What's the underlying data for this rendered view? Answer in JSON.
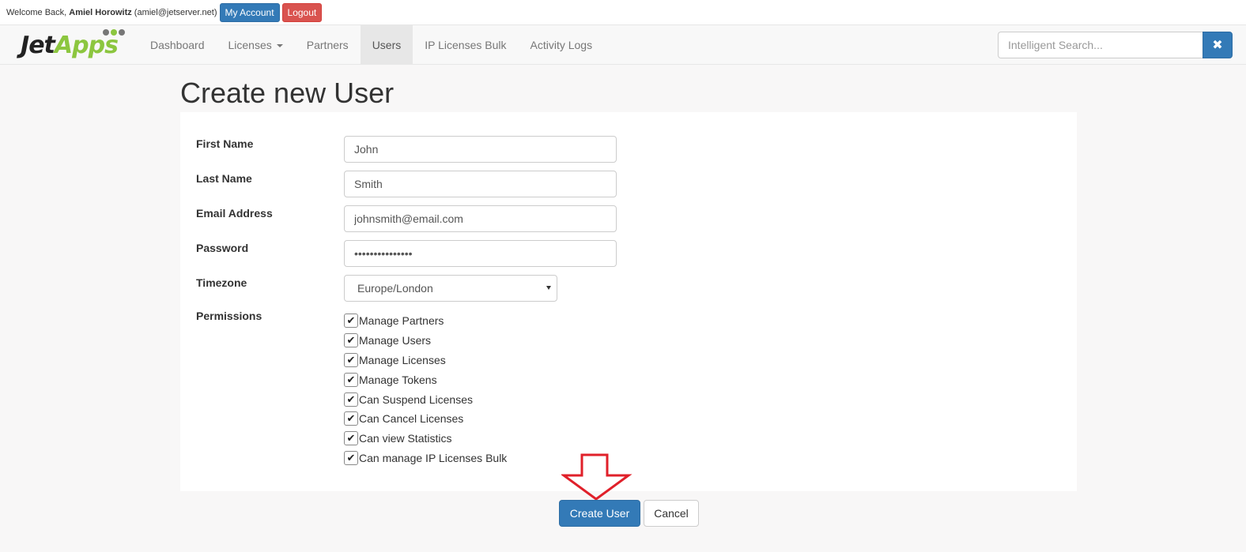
{
  "topbar": {
    "welcome_prefix": "Welcome Back,",
    "user_name": "Amiel Horowitz",
    "user_email": "(amiel@jetserver.net)",
    "my_account_label": "My Account",
    "logout_label": "Logout"
  },
  "navbar": {
    "logo": {
      "part1": "Jet",
      "part2": "Apps"
    },
    "items": [
      {
        "label": "Dashboard",
        "active": false
      },
      {
        "label": "Licenses",
        "active": false,
        "dropdown": true
      },
      {
        "label": "Partners",
        "active": false
      },
      {
        "label": "Users",
        "active": true
      },
      {
        "label": "IP Licenses Bulk",
        "active": false
      },
      {
        "label": "Activity Logs",
        "active": false
      }
    ],
    "search": {
      "placeholder": "Intelligent Search...",
      "value": ""
    }
  },
  "page": {
    "title": "Create new User"
  },
  "form": {
    "first_name": {
      "label": "First Name",
      "value": "John"
    },
    "last_name": {
      "label": "Last Name",
      "value": "Smith"
    },
    "email": {
      "label": "Email Address",
      "value": "johnsmith@email.com"
    },
    "password": {
      "label": "Password",
      "value": "•••••••••••••••"
    },
    "timezone": {
      "label": "Timezone",
      "value": "Europe/London"
    },
    "permissions": {
      "label": "Permissions",
      "items": [
        {
          "label": "Manage Partners",
          "checked": true
        },
        {
          "label": "Manage Users",
          "checked": true
        },
        {
          "label": "Manage Licenses",
          "checked": true
        },
        {
          "label": "Manage Tokens",
          "checked": true
        },
        {
          "label": "Can Suspend Licenses",
          "checked": true
        },
        {
          "label": "Can Cancel Licenses",
          "checked": true
        },
        {
          "label": "Can view Statistics",
          "checked": true
        },
        {
          "label": "Can manage IP Licenses Bulk",
          "checked": true
        }
      ]
    }
  },
  "actions": {
    "create_label": "Create User",
    "cancel_label": "Cancel"
  },
  "colors": {
    "primary": "#337ab7",
    "danger": "#d9534f",
    "logo_green": "#8cc63f",
    "annotation_red": "#e0202a"
  },
  "icons": {
    "search_clear": "close-icon",
    "check": "checkmark-icon",
    "annotation": "down-arrow-icon"
  }
}
